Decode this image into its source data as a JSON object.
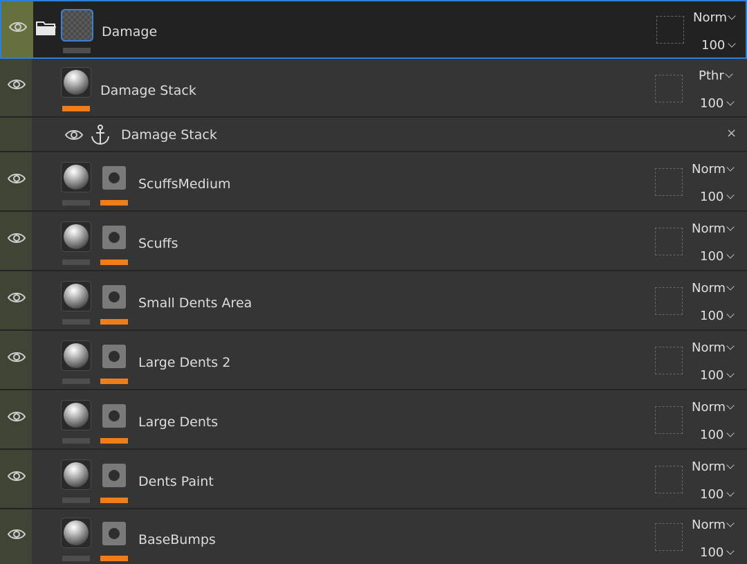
{
  "layers": [
    {
      "name": "Damage",
      "type": "folder",
      "blend_mode": "Norm",
      "opacity": "100",
      "selected": true
    },
    {
      "name": "Damage Stack",
      "type": "fill",
      "blend_mode": "Pthr",
      "opacity": "100",
      "sub_effect": {
        "name": "Damage Stack",
        "icon": "anchor-icon",
        "close_label": "×"
      }
    },
    {
      "name": "ScuffsMedium",
      "type": "fill-masked",
      "blend_mode": "Norm",
      "opacity": "100"
    },
    {
      "name": "Scuffs",
      "type": "fill-masked",
      "blend_mode": "Norm",
      "opacity": "100"
    },
    {
      "name": "Small Dents Area",
      "type": "fill-masked",
      "blend_mode": "Norm",
      "opacity": "100"
    },
    {
      "name": "Large Dents 2",
      "type": "fill-masked",
      "blend_mode": "Norm",
      "opacity": "100"
    },
    {
      "name": "Large Dents",
      "type": "fill-masked",
      "blend_mode": "Norm",
      "opacity": "100"
    },
    {
      "name": "Dents Paint",
      "type": "fill-masked",
      "blend_mode": "Norm",
      "opacity": "100"
    },
    {
      "name": "BaseBumps",
      "type": "fill-masked",
      "blend_mode": "Norm",
      "opacity": "100"
    }
  ],
  "colors": {
    "accent_orange": "#ef7d1a",
    "selection_blue": "#2f7ed8",
    "visibility_strip": "#3f4535"
  }
}
